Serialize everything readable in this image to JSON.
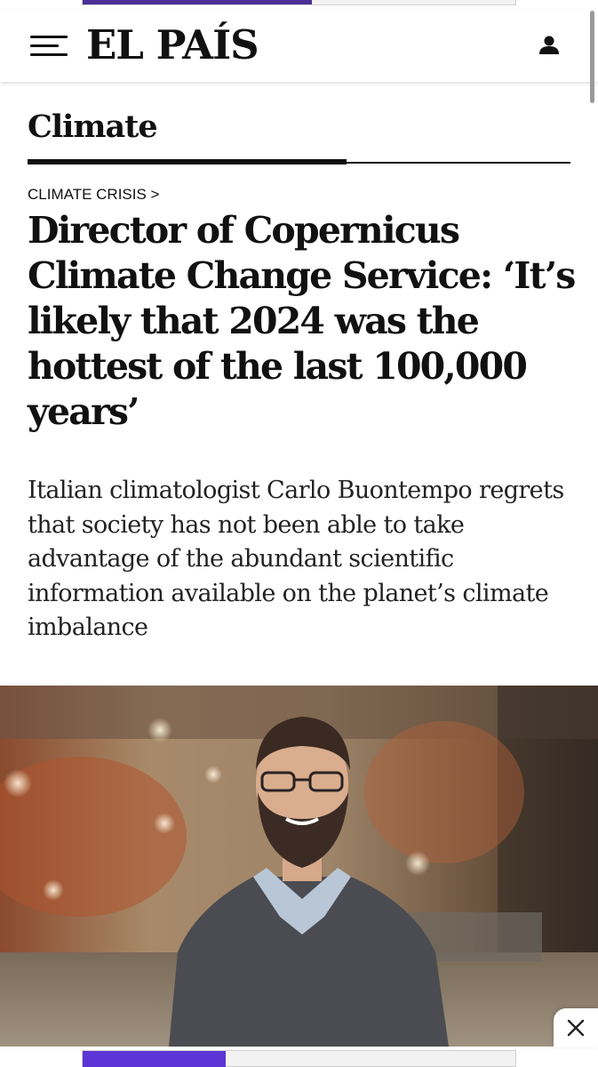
{
  "ads": {
    "top_fill_fraction": 0.53,
    "bottom_fill_fraction": 0.33,
    "accent": "#5b35d5"
  },
  "header": {
    "logo": "EL PAÍS",
    "menu_icon": "hamburger-menu-icon",
    "account_icon": "user-icon"
  },
  "section": {
    "title": "Climate"
  },
  "article": {
    "kicker": "CLIMATE CRISIS >",
    "headline": "Director of Copernicus Climate Change Service: ‘It’s likely that 2024 was the hottest of the last 100,000 years’",
    "standfirst": "Italian climatologist Carlo Buontempo regrets that society has not been able to take advantage of the abundant scientific information available on the planet’s climate imbalance"
  },
  "close_icon": "close-icon"
}
